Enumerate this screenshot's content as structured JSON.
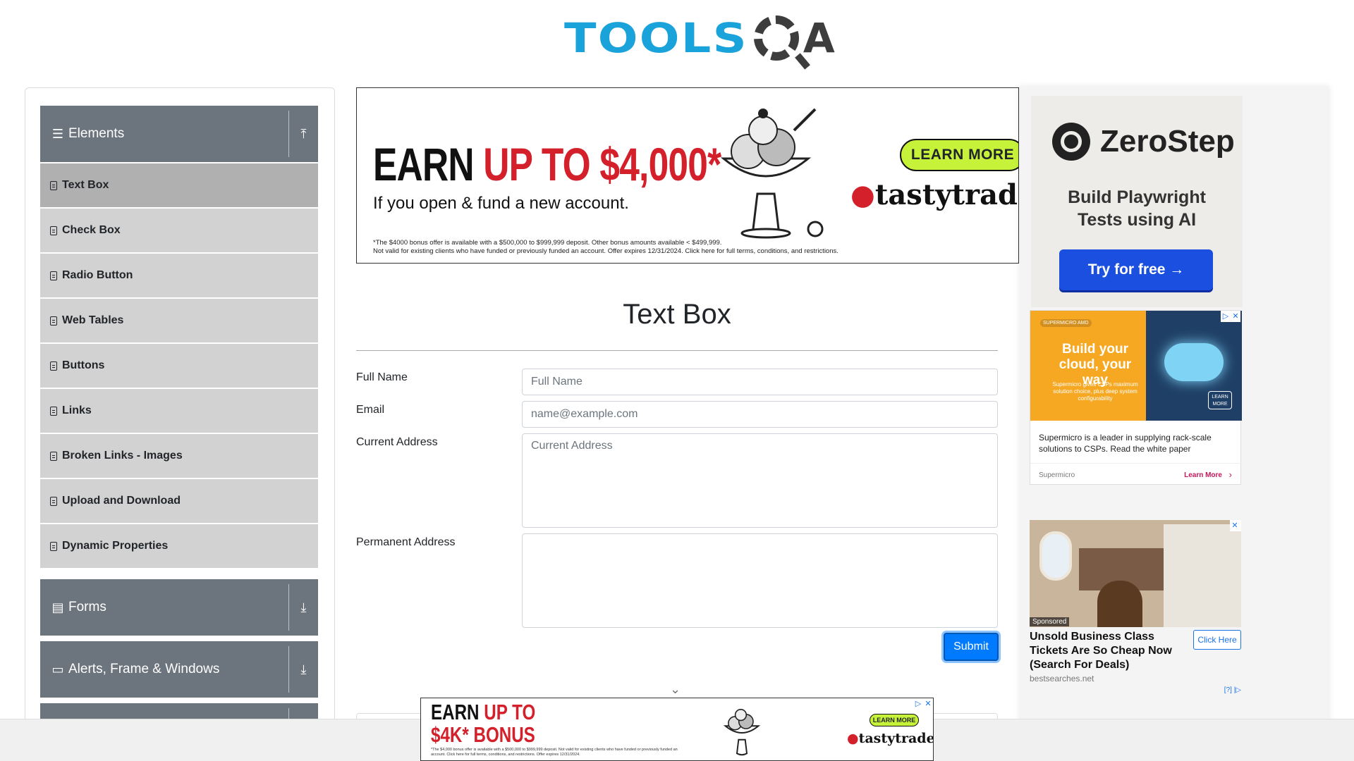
{
  "header": {
    "logo_tools": "TOOLS",
    "logo_qa": "A"
  },
  "sidebar": {
    "groups": [
      {
        "label": "Elements",
        "icon": "hamburger-icon",
        "toggle_icon": "collapse-up-icon"
      },
      {
        "label": "Forms",
        "icon": "document-icon",
        "toggle_icon": "expand-down-icon"
      },
      {
        "label": "Alerts, Frame & Windows",
        "icon": "window-icon",
        "toggle_icon": "expand-down-icon"
      }
    ],
    "items": [
      {
        "label": "Text Box",
        "active": true
      },
      {
        "label": "Check Box"
      },
      {
        "label": "Radio Button"
      },
      {
        "label": "Web Tables"
      },
      {
        "label": "Buttons"
      },
      {
        "label": "Links"
      },
      {
        "label": "Broken Links - Images"
      },
      {
        "label": "Upload and Download"
      },
      {
        "label": "Dynamic Properties"
      }
    ]
  },
  "banner_ad": {
    "headline_black": "EARN ",
    "headline_red": "UP TO $4,000*",
    "subline": "If you open & fund a new account.",
    "fine_print_1": "*The $4000 bonus offer is available with a $500,000 to $999,999 deposit. Other bonus amounts available < $499,999.",
    "fine_print_2": "Not valid for existing clients who have funded or previously funded an account. Offer expires 12/31/2024. Click here for full terms, conditions, and restrictions.",
    "cta": "LEARN MORE",
    "brand": "tastytrade"
  },
  "form": {
    "title": "Text Box",
    "full_name": {
      "label": "Full Name",
      "placeholder": "Full Name",
      "value": ""
    },
    "email": {
      "label": "Email",
      "placeholder": "name@example.com",
      "value": ""
    },
    "current_address": {
      "label": "Current Address",
      "placeholder": "Current Address",
      "value": ""
    },
    "permanent_address": {
      "label": "Permanent Address",
      "placeholder": "",
      "value": ""
    },
    "submit_label": "Submit"
  },
  "right_ads": {
    "zerostep": {
      "brand": "ZeroStep",
      "tagline_1": "Build Playwright",
      "tagline_2": "Tests using AI",
      "cta": "Try for free →"
    },
    "supermicro": {
      "logos": "SUPERMICRO  AMD",
      "headline": "Build your cloud, your way",
      "small": "Supermicro gives CSPs maximum solution choice, plus deep system configurability",
      "learn_badge": "LEARN MORE",
      "body": "Supermicro is a leader in supplying rack-scale solutions to CSPs. Read the white paper",
      "source": "Supermicro",
      "cta": "Learn More"
    },
    "business_class": {
      "sponsored": "Sponsored",
      "headline": "Unsold Business Class Tickets Are So Cheap Now (Search For Deals)",
      "domain": "bestsearches.net",
      "cta": "Click Here",
      "adinfo": "[?]"
    }
  },
  "bottom_ad": {
    "line1_black": "EARN ",
    "line1_red": "UP TO",
    "line2_red": "$4K* BONUS",
    "fine_print": "*The $4,000 bonus offer is available with a $500,000 to $999,999 deposit. Not valid for existing clients who have funded or previously funded an account. Click here for full terms, conditions, and restrictions. Offer expires 12/31/2024.",
    "cta": "LEARN MORE",
    "brand": "tastytrade"
  }
}
